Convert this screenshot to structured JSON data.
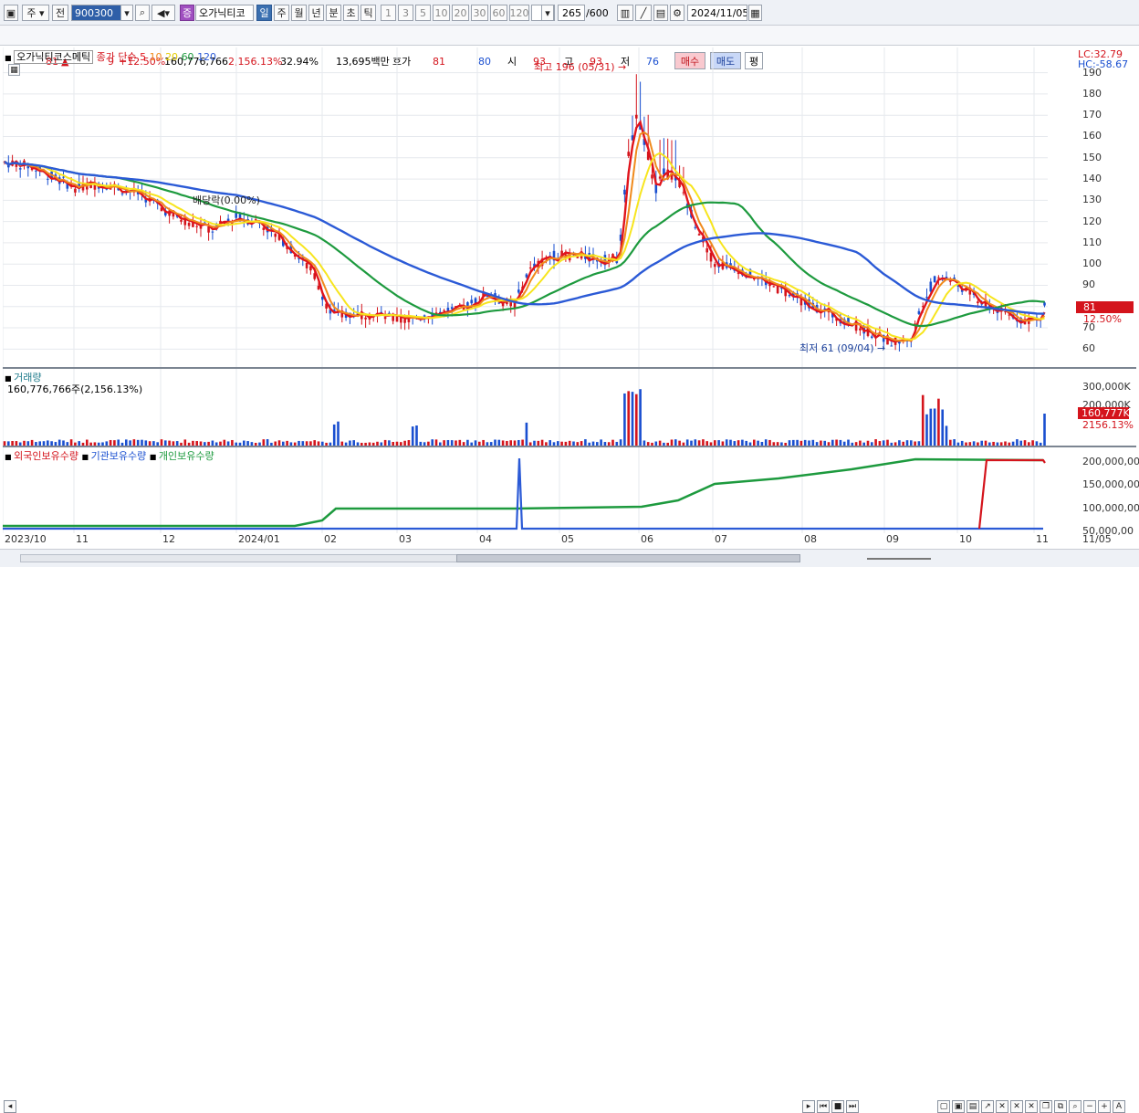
{
  "toolbar": {
    "period_code": "주",
    "prev_label": "전",
    "code_value": "900300",
    "stock_badge": "증",
    "stock_name": "오가닉티코",
    "tabs": [
      "일",
      "주",
      "월",
      "년",
      "분",
      "초",
      "틱"
    ],
    "intervals": [
      "1",
      "3",
      "5",
      "10",
      "20",
      "30",
      "60",
      "120"
    ],
    "count_value": "265",
    "count_max": "/600",
    "date_value": "2024/11/05"
  },
  "quote": {
    "price": "81",
    "change_arrow": "▲",
    "change": "9",
    "change_pct": "+12.50%",
    "volume": "160,776,766",
    "vol_ratio": "2,156.13%",
    "turnover": "32.94%",
    "amount": "13,695백만",
    "hoga_label": "호가",
    "ask": "81",
    "bid": "80",
    "open_label": "시",
    "open": "93",
    "high_label": "고",
    "high": "93",
    "low_label": "저",
    "low": "76",
    "buy_label": "매수",
    "sell_label": "매도",
    "even_label": "평"
  },
  "price_panel": {
    "legend_name": "오가닉티코스메틱",
    "legend_ma_label": "종가 단순",
    "ma_labels": [
      "5",
      "10",
      "20",
      "60",
      "120"
    ],
    "lc": "LC:32.79",
    "hc": "HC:-58.67",
    "high_annotation": "최고 196 (05/31)",
    "low_annotation": "최저 61 (09/04)",
    "dividend_annotation": "배당락(0.00%)",
    "current_price_tag": "81",
    "current_pct_tag": "12.50%",
    "y_ticks": [
      "190",
      "180",
      "170",
      "160",
      "150",
      "140",
      "130",
      "120",
      "110",
      "100",
      "90",
      "80",
      "70",
      "60"
    ]
  },
  "volume_panel": {
    "title": "거래량",
    "value_text": "160,776,766주(2,156.13%)",
    "y_ticks": [
      "300,000K",
      "200,000K",
      "100,000K"
    ],
    "current_tag": "160,777K",
    "current_pct": "2156.13%"
  },
  "holding_panel": {
    "series_labels": [
      "외국인보유수량",
      "기관보유수량",
      "개인보유수량"
    ],
    "y_ticks": [
      "200,000,00",
      "150,000,00",
      "100,000,00",
      "50,000,00"
    ]
  },
  "x_axis": {
    "labels": [
      "2023/10",
      "11",
      "12",
      "2024/01",
      "02",
      "03",
      "04",
      "05",
      "06",
      "07",
      "08",
      "09",
      "10",
      "11",
      "11/05"
    ]
  },
  "colors": {
    "up": "#d4141c",
    "down": "#1a4fd0",
    "ma5": "#e0141c",
    "ma10": "#f08a1c",
    "ma20": "#f7e51e",
    "ma60": "#1d9a3e",
    "ma120": "#2b5ad6"
  },
  "chart_data": {
    "type": "candlestick",
    "x": [
      "2023/10",
      "11",
      "12",
      "2024/01",
      "02",
      "03",
      "04",
      "05",
      "06",
      "07",
      "08",
      "09",
      "10",
      "11"
    ],
    "close_approx": [
      148,
      138,
      135,
      118,
      110,
      74,
      77,
      95,
      104,
      150,
      100,
      75,
      92,
      81
    ],
    "series": [
      {
        "name": "5",
        "color": "#e0141c"
      },
      {
        "name": "10",
        "color": "#f08a1c"
      },
      {
        "name": "20",
        "color": "#f7e51e"
      },
      {
        "name": "60",
        "color": "#1d9a3e"
      },
      {
        "name": "120",
        "color": "#2b5ad6"
      }
    ],
    "ylim": [
      55,
      195
    ],
    "high": {
      "value": 196,
      "date": "05/31"
    },
    "low": {
      "value": 61,
      "date": "09/04"
    }
  }
}
